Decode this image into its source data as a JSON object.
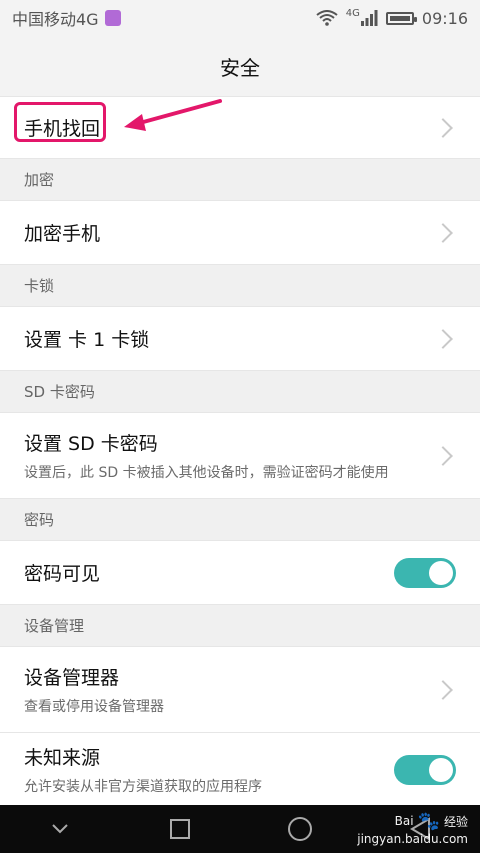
{
  "status_bar": {
    "carrier": "中国移动4G",
    "network": "4G",
    "time": "09:16"
  },
  "header": {
    "title": "安全"
  },
  "items": {
    "phone_find": {
      "label": "手机找回"
    },
    "section_encrypt": {
      "label": "加密"
    },
    "encrypt_phone": {
      "label": "加密手机"
    },
    "section_card_lock": {
      "label": "卡锁"
    },
    "set_card_lock": {
      "label": "设置 卡 1 卡锁"
    },
    "section_sd": {
      "label": "SD 卡密码"
    },
    "set_sd_password": {
      "label": "设置 SD 卡密码",
      "sub": "设置后，此 SD 卡被插入其他设备时，需验证密码才能使用"
    },
    "section_password": {
      "label": "密码"
    },
    "password_visible": {
      "label": "密码可见",
      "enabled": true
    },
    "section_device_admin": {
      "label": "设备管理"
    },
    "device_admin": {
      "label": "设备管理器",
      "sub": "查看或停用设备管理器"
    },
    "unknown_sources": {
      "label": "未知来源",
      "sub": "允许安装从非官方渠道获取的应用程序",
      "enabled": true
    }
  },
  "overlay": {
    "highlight_color": "#e3176a",
    "toggle_color": "#3bb6b0"
  },
  "watermark": {
    "brand": "Bai",
    "brand_suffix": "经验",
    "site": "jingyan.baidu.com"
  }
}
